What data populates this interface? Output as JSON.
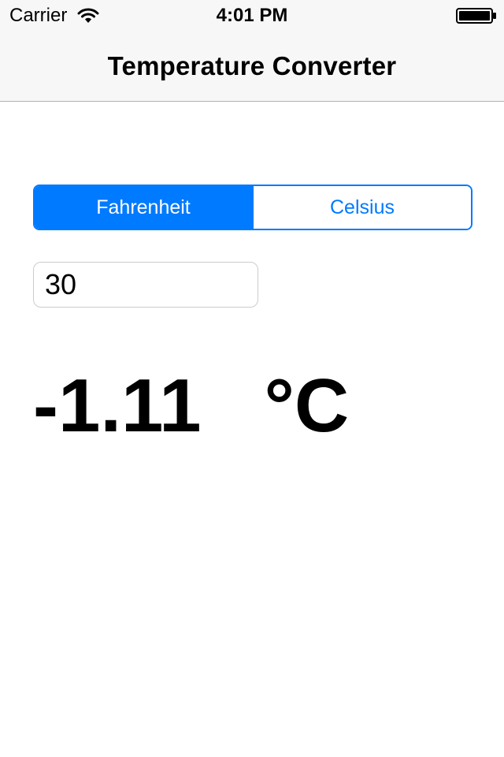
{
  "status_bar": {
    "carrier": "Carrier",
    "time": "4:01 PM",
    "wifi_icon": "wifi-icon",
    "battery_icon": "battery-full-icon"
  },
  "nav": {
    "title": "Temperature Converter"
  },
  "segmented_control": {
    "options": [
      "Fahrenheit",
      "Celsius"
    ],
    "selected": "Fahrenheit"
  },
  "input": {
    "value": "30"
  },
  "result": {
    "value": "-1.11",
    "unit": "°C"
  },
  "colors": {
    "accent": "#007aff",
    "nav_background": "#f7f7f7",
    "background": "#ffffff",
    "text": "#000000"
  }
}
